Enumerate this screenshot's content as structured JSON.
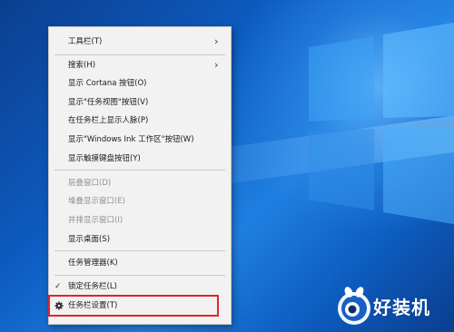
{
  "context_menu": {
    "items": [
      {
        "label": "工具栏(T)",
        "has_submenu": true,
        "enabled": true
      },
      {
        "label": "搜索(H)",
        "has_submenu": true,
        "enabled": true
      },
      {
        "label": "显示 Cortana 按钮(O)",
        "enabled": true
      },
      {
        "label": "显示\"任务视图\"按钮(V)",
        "enabled": true
      },
      {
        "label": "在任务栏上显示人脉(P)",
        "enabled": true
      },
      {
        "label": "显示\"Windows Ink 工作区\"按钮(W)",
        "enabled": true
      },
      {
        "label": "显示触摸键盘按钮(Y)",
        "enabled": true
      },
      {
        "label": "层叠窗口(D)",
        "enabled": false
      },
      {
        "label": "堆叠显示窗口(E)",
        "enabled": false
      },
      {
        "label": "并排显示窗口(I)",
        "enabled": false
      },
      {
        "label": "显示桌面(S)",
        "enabled": true
      },
      {
        "label": "任务管理器(K)",
        "enabled": true
      },
      {
        "label": "锁定任务栏(L)",
        "checked": true,
        "enabled": true
      },
      {
        "label": "任务栏设置(T)",
        "icon": "gear-icon",
        "enabled": true,
        "highlighted": true
      }
    ],
    "submenu_arrow": "›",
    "check_mark": "✓"
  },
  "watermark": {
    "text": "好装机"
  },
  "colors": {
    "desktop_blue": "#0d5bc0",
    "menu_background": "#f2f2f2",
    "highlight_border": "#e0242a",
    "disabled_text": "#8f8f8f"
  }
}
